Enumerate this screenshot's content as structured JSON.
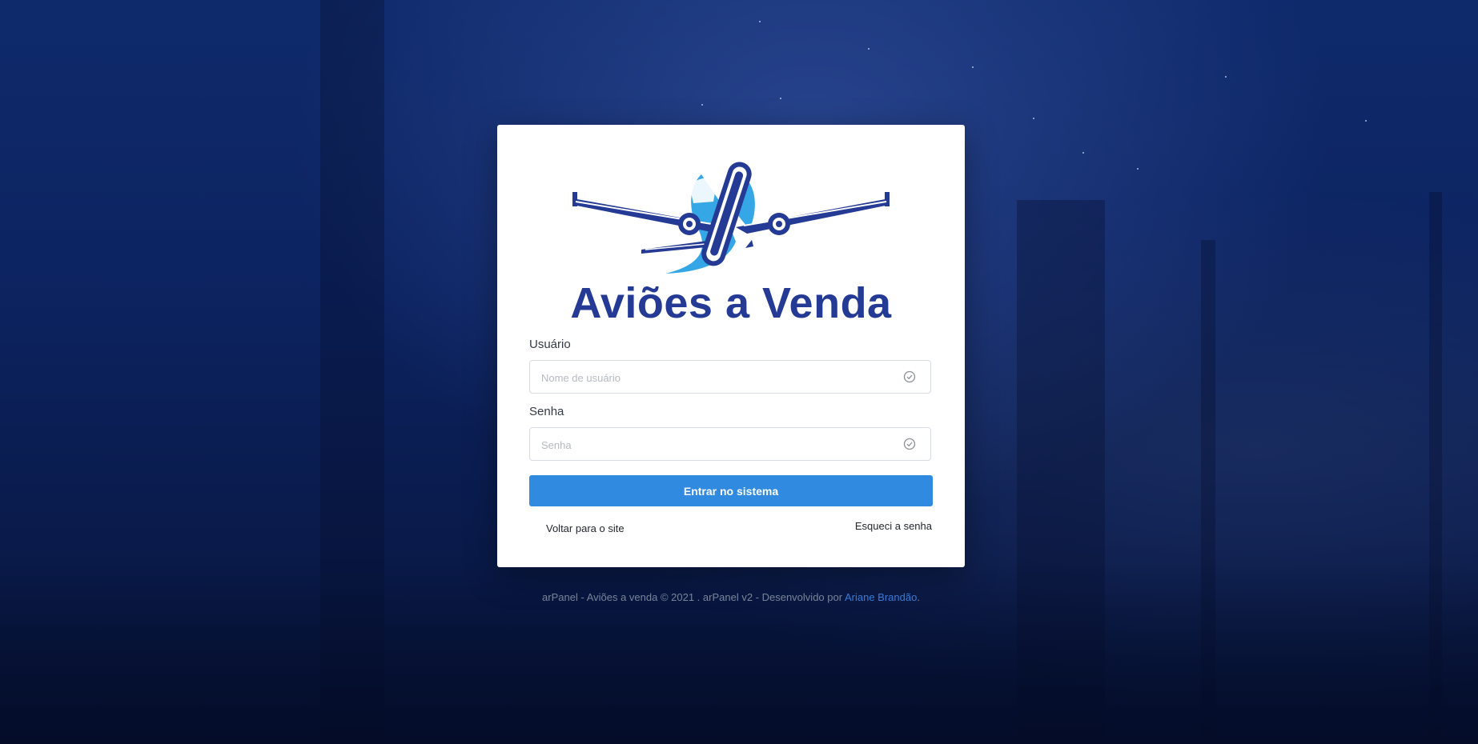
{
  "brand": {
    "logo_icon": "airplane-logo-icon",
    "name": "Aviões a Venda",
    "color": "#243a94",
    "accent": "#35a7e6"
  },
  "form": {
    "username": {
      "label": "Usuário",
      "placeholder": "Nome de usuário",
      "value": "",
      "icon": "check-circle-icon"
    },
    "password": {
      "label": "Senha",
      "placeholder": "Senha",
      "value": "",
      "icon": "check-circle-icon"
    },
    "submit_label": "Entrar no sistema",
    "submit_color": "#2f8ae0",
    "back_link": "Voltar para o site",
    "forgot_link": "Esqueci a senha"
  },
  "footer": {
    "text": "arPanel - Aviões a venda © 2021 . arPanel v2 - Desenvolvido por",
    "author": "Ariane Brandão",
    "suffix": "."
  }
}
